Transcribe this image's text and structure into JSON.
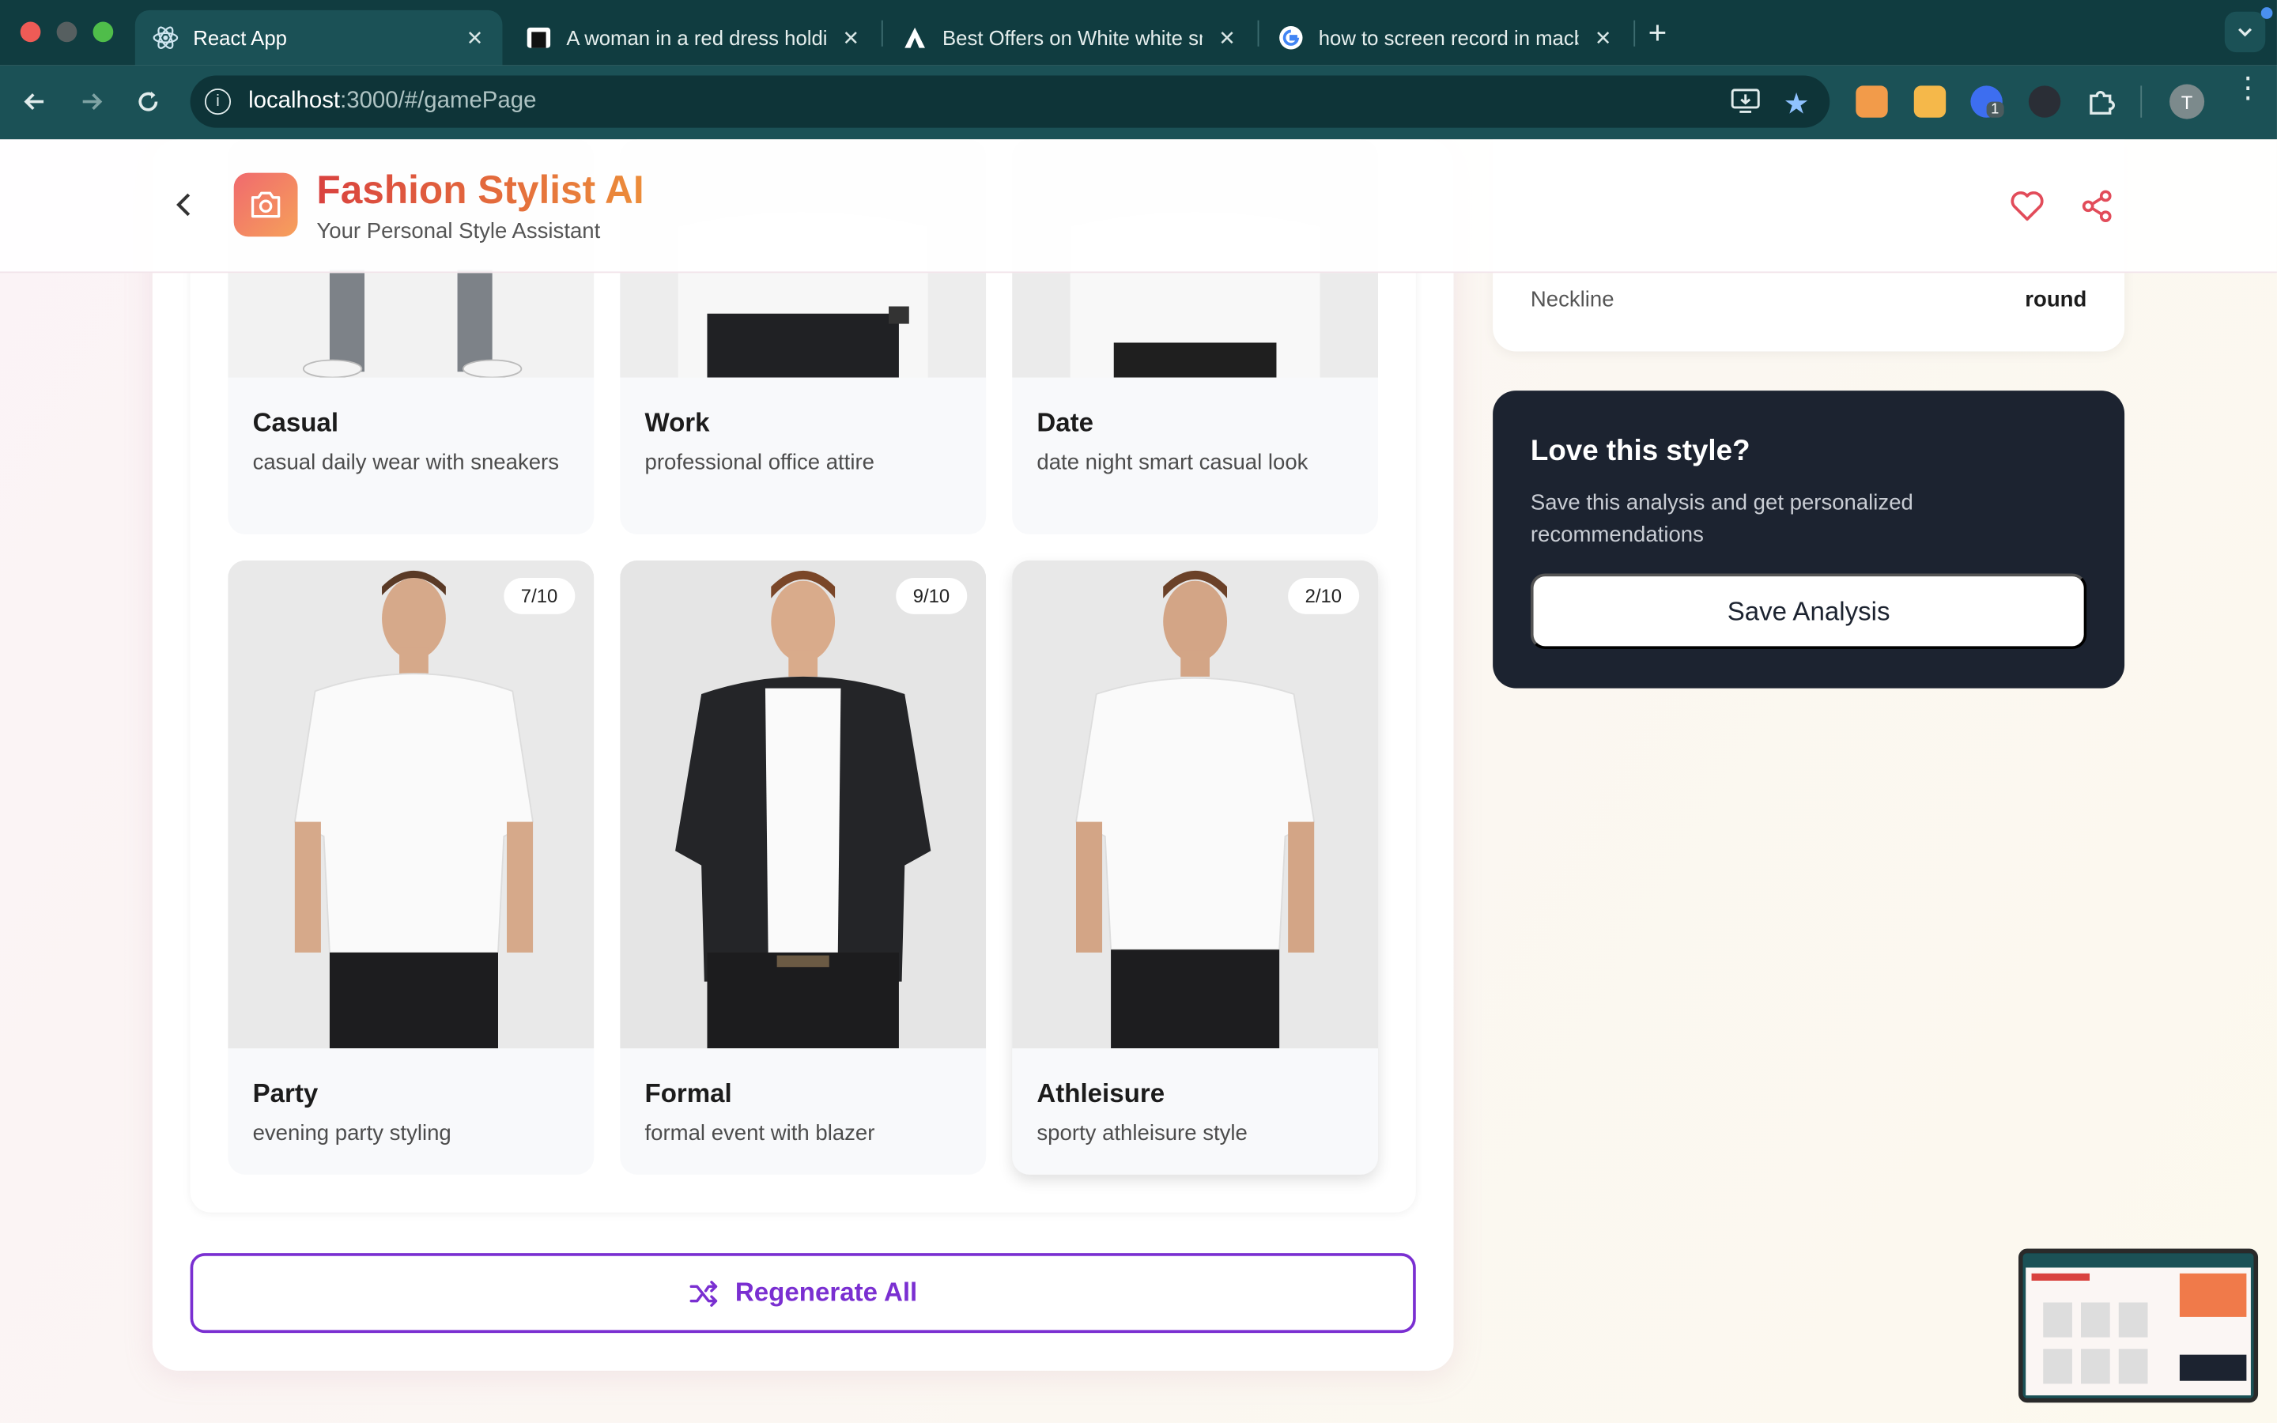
{
  "browser": {
    "tabs": [
      {
        "title": "React App",
        "favicon": "react-icon",
        "active": true
      },
      {
        "title": "A woman in a red dress holdir",
        "favicon": "brand-icon",
        "active": false
      },
      {
        "title": "Best Offers on White white sn",
        "favicon": "a-logo-icon",
        "active": false
      },
      {
        "title": "how to screen record in macb",
        "favicon": "google-icon",
        "active": false
      }
    ],
    "url_host": "localhost",
    "url_rest": ":3000/#/gamePage",
    "profile_initial": "T",
    "extension_badge": "1"
  },
  "app": {
    "title": "Fashion Stylist AI",
    "subtitle": "Your Personal Style Assistant"
  },
  "outfits_top": [
    {
      "name": "Casual",
      "desc": "casual daily wear with sneakers"
    },
    {
      "name": "Work",
      "desc": "professional office attire"
    },
    {
      "name": "Date",
      "desc": "date night smart casual look"
    }
  ],
  "outfits_bottom": [
    {
      "name": "Party",
      "desc": "evening party styling",
      "score": "7/10"
    },
    {
      "name": "Formal",
      "desc": "formal event with blazer",
      "score": "9/10"
    },
    {
      "name": "Athleisure",
      "desc": "sporty athleisure style",
      "score": "2/10"
    }
  ],
  "regenerate_label": "Regenerate All",
  "analysis": {
    "neckline_label": "Neckline",
    "neckline_value": "round"
  },
  "cta": {
    "title": "Love this style?",
    "text": "Save this analysis and get personalized recommendations",
    "button": "Save Analysis"
  },
  "colors": {
    "browser_bg": "#103c40",
    "accent_purple": "#7a2fd1",
    "brand_red": "#d9423f",
    "cta_bg": "#1c2330"
  }
}
